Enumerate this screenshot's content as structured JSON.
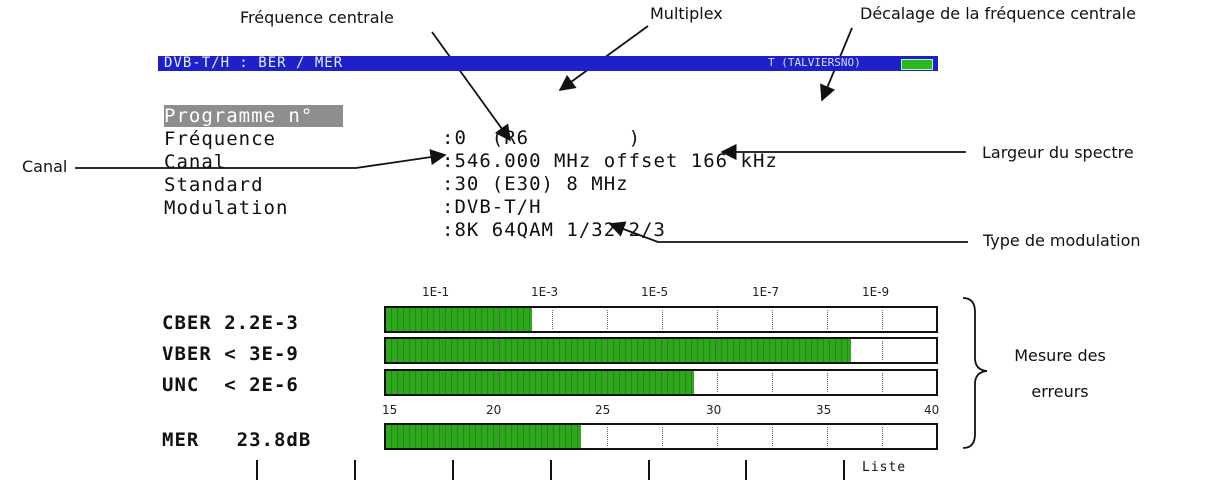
{
  "annotations": {
    "frequence_centrale": "Fréquence centrale",
    "multiplex": "Multiplex",
    "decalage": "Décalage de la fréquence centrale",
    "canal": "Canal",
    "largeur": "Largeur du spectre",
    "type_modulation": "Type de modulation",
    "mesure_line1": "Mesure des",
    "mesure_line2": "erreurs"
  },
  "screen": {
    "header_title": "DVB-T/H : BER / MER",
    "header_right": "T (TALVIERSNO)",
    "fields": [
      {
        "label": "Programme n°",
        "value": "0  (R6        )"
      },
      {
        "label": "Fréquence",
        "value": "546.000 MHz offset 166 kHz"
      },
      {
        "label": "Canal",
        "value": "30 (E30) 8 MHz"
      },
      {
        "label": "Standard",
        "value": "DVB-T/H"
      },
      {
        "label": "Modulation",
        "value": "8K 64QAM 1/32 2/3"
      }
    ],
    "field_separator": ":",
    "ber_scale": [
      "1E-1",
      "1E-3",
      "1E-5",
      "1E-7",
      "1E-9"
    ],
    "measures": [
      {
        "name": "CBER",
        "value": "2.2E-3",
        "fill_fraction": 0.265
      },
      {
        "name": "VBER",
        "value": "< 3E-9",
        "fill_fraction": 0.845
      },
      {
        "name": "UNC",
        "value": "< 2E-6",
        "fill_fraction": 0.56
      }
    ],
    "mer_scale": [
      "15",
      "20",
      "25",
      "30",
      "35",
      "40"
    ],
    "mer": {
      "name": "MER",
      "value": "23.8dB",
      "fill_fraction": 0.355
    },
    "softkey_liste": "Liste"
  },
  "colors": {
    "header_bg": "#1d21c9",
    "bar_green": "#2fa81e",
    "battery": "#2ab71f"
  }
}
